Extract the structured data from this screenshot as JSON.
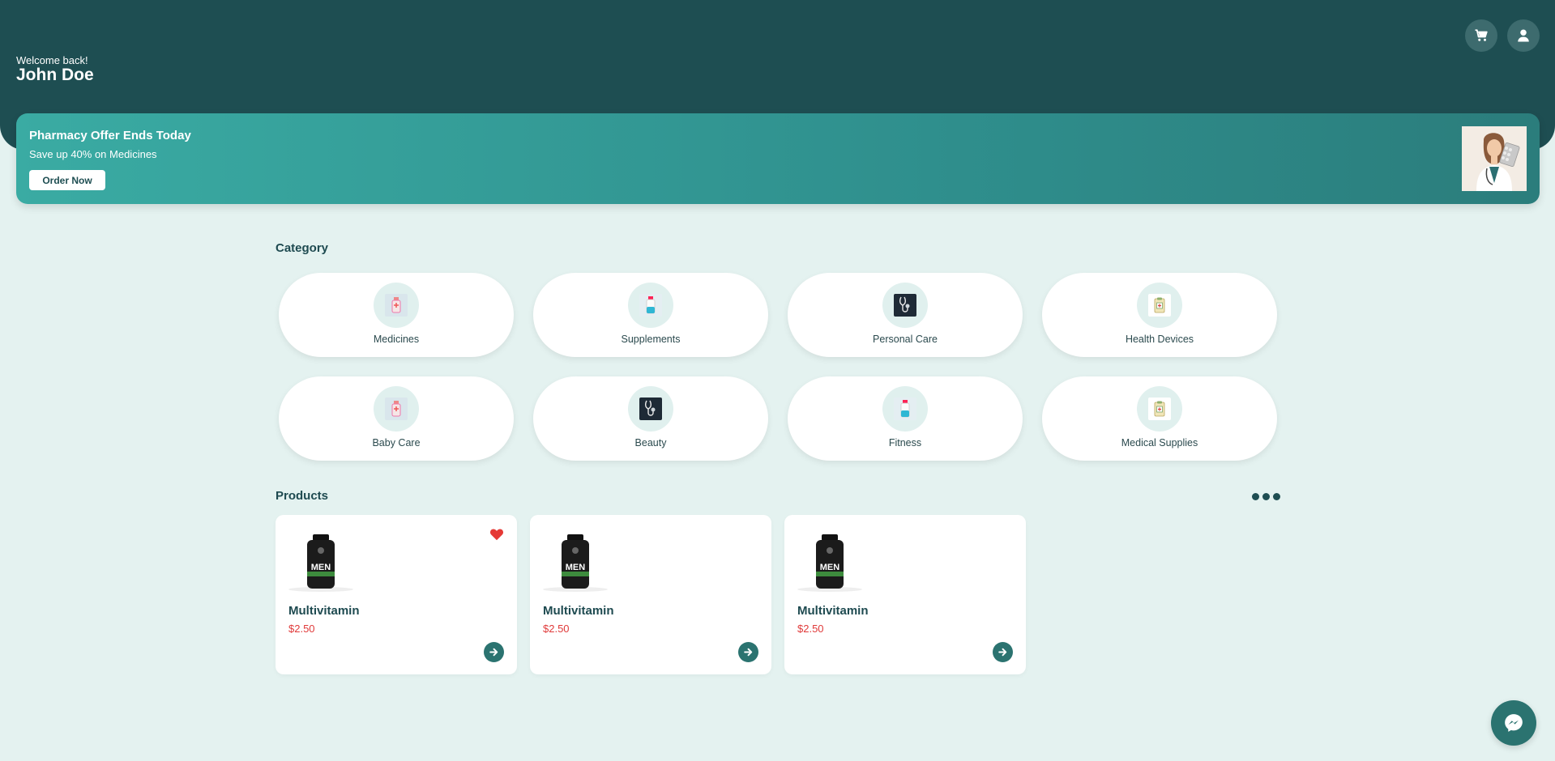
{
  "header": {
    "welcome": "Welcome back!",
    "username": "John Doe",
    "cart_icon": "cart-icon",
    "user_icon": "user-icon"
  },
  "banner": {
    "title": "Pharmacy Offer Ends Today",
    "subtitle": "Save up 40% on Medicines",
    "button": "Order Now"
  },
  "category": {
    "title": "Category",
    "items": [
      {
        "label": "Medicines",
        "icon": "medicine-bottle-icon"
      },
      {
        "label": "Supplements",
        "icon": "supplement-bottle-icon"
      },
      {
        "label": "Personal Care",
        "icon": "stethoscope-icon"
      },
      {
        "label": "Health Devices",
        "icon": "clipboard-icon"
      },
      {
        "label": "Baby Care",
        "icon": "medicine-bottle-icon"
      },
      {
        "label": "Beauty",
        "icon": "stethoscope-icon"
      },
      {
        "label": "Fitness",
        "icon": "supplement-bottle-icon"
      },
      {
        "label": "Medical Supplies",
        "icon": "clipboard-icon"
      }
    ]
  },
  "products": {
    "title": "Products",
    "items": [
      {
        "name": "Multivitamin",
        "price": "$2.50",
        "favorite": true,
        "bottle_label": "MEN"
      },
      {
        "name": "Multivitamin",
        "price": "$2.50",
        "favorite": false,
        "bottle_label": "MEN"
      },
      {
        "name": "Multivitamin",
        "price": "$2.50",
        "favorite": false,
        "bottle_label": "MEN"
      }
    ]
  },
  "colors": {
    "header": "#1e4e52",
    "accent": "#2b7370",
    "price": "#e03a3a",
    "background": "#e4f2f0"
  }
}
